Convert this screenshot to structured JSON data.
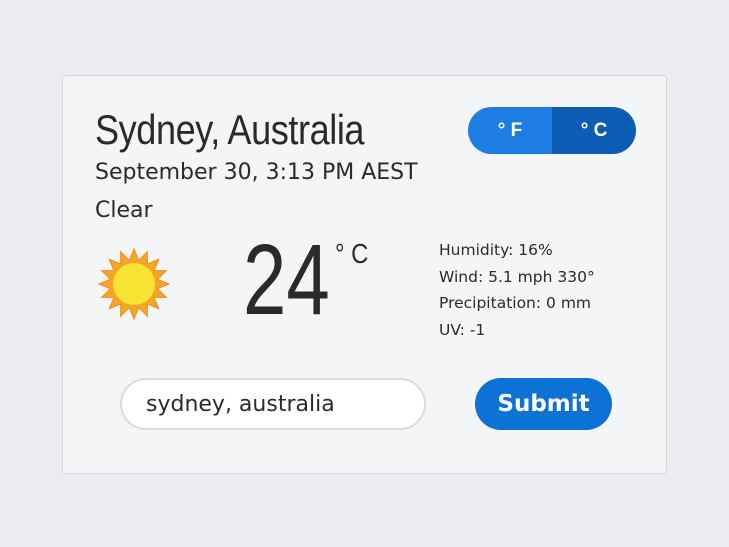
{
  "location": {
    "city": "Sydney, Australia",
    "datetime": "September 30, 3:13 PM AEST",
    "condition": "Clear"
  },
  "unit_toggle": {
    "fahrenheit_label": "° F",
    "celsius_label": "° C",
    "selected": "celsius"
  },
  "current": {
    "temperature": "24",
    "unit": "° C",
    "icon": "sun-icon"
  },
  "details": {
    "humidity": "Humidity: 16%",
    "wind": "Wind: 5.1 mph 330°",
    "precipitation": "Precipitation: 0 mm",
    "uv": "UV: -1"
  },
  "search": {
    "value": "sydney, australia",
    "submit_label": "Submit"
  },
  "colors": {
    "toggle_f": "#1d7de2",
    "toggle_c": "#0d5db5",
    "submit": "#0d72d6",
    "sun_fill": "#f7e434",
    "sun_rays": "#f5a623"
  }
}
